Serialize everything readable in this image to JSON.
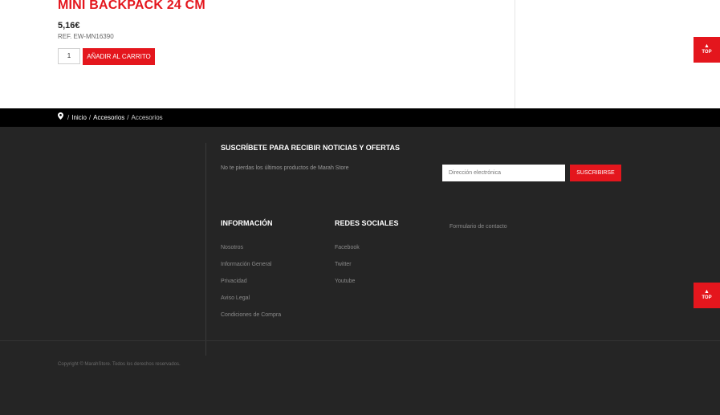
{
  "product": {
    "title": "MINI BACKPACK 24 CM",
    "price": "5,16€",
    "reference": "REF. EW-MN16390",
    "quantity": "1",
    "add_to_cart_label": "AÑADIR AL CARRITO"
  },
  "top_button": {
    "label": "TOP",
    "arrow": "▲"
  },
  "breadcrumb": {
    "items": [
      "Inicio",
      "Accesorios",
      "Accesorios"
    ],
    "separator": "/"
  },
  "newsletter": {
    "title": "SUSCRÍBETE PARA RECIBIR NOTICIAS Y OFERTAS",
    "description": "No te pierdas los últimos productos de Marah Store",
    "input_placeholder": "Dirección electrónica",
    "button_label": "SUSCRIBIRSE"
  },
  "footer": {
    "informacion": {
      "title": "INFORMACIÓN",
      "links": [
        "Nosotros",
        "Información General",
        "Privacidad",
        "Aviso Legal",
        "Condiciones de Compra"
      ]
    },
    "redes": {
      "title": "REDES SOCIALES",
      "links": [
        "Facebook",
        "Twitter",
        "Youtube"
      ]
    },
    "contact_link": "Formulario de contacto",
    "copyright": "Copyright © MarahStore. Todos los derechos reservados."
  },
  "colors": {
    "accent": "#e4161d",
    "footer_bg": "#252525",
    "breadcrumb_bg": "#000000"
  }
}
